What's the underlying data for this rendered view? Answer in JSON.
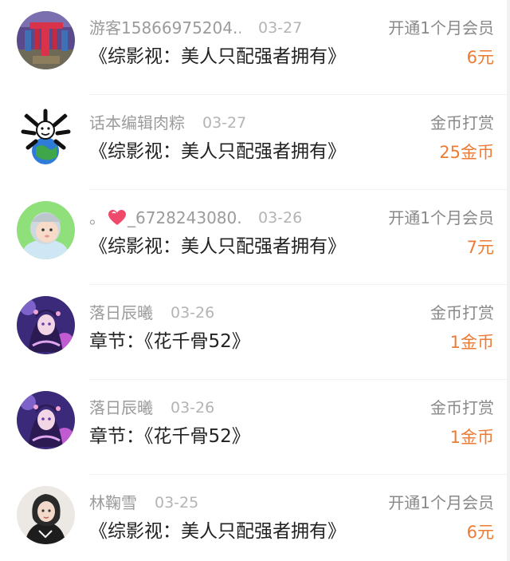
{
  "accent_color": "#ee7b34",
  "records": [
    {
      "user": "游客15866975204...",
      "date": "03-27",
      "content": "《综影视：美人只配强者拥有》",
      "type": "开通1个月会员",
      "amount": "6元",
      "avatar": "red-chair-photo"
    },
    {
      "user": "话本编辑肉粽",
      "date": "03-27",
      "content": "《综影视：美人只配强者拥有》",
      "type": "金币打赏",
      "amount": "25金币",
      "avatar": "cartoon-bones-earth"
    },
    {
      "user_prefix": "。",
      "user": "_6728243080...",
      "date": "03-26",
      "content": "《综影视：美人只配强者拥有》",
      "type": "开通1个月会员",
      "amount": "7元",
      "avatar": "baby-photo"
    },
    {
      "user": "落日辰曦",
      "date": "03-26",
      "content": "章节：《花千骨52》",
      "type": "金币打赏",
      "amount": "1金币",
      "avatar": "anime-girl"
    },
    {
      "user": "落日辰曦",
      "date": "03-26",
      "content": "章节：《花千骨52》",
      "type": "金币打赏",
      "amount": "1金币",
      "avatar": "anime-girl"
    },
    {
      "user": "林鞠雪",
      "date": "03-25",
      "content": "《综影视：美人只配强者拥有》",
      "type": "开通1个月会员",
      "amount": "6元",
      "avatar": "woman-photo"
    }
  ]
}
